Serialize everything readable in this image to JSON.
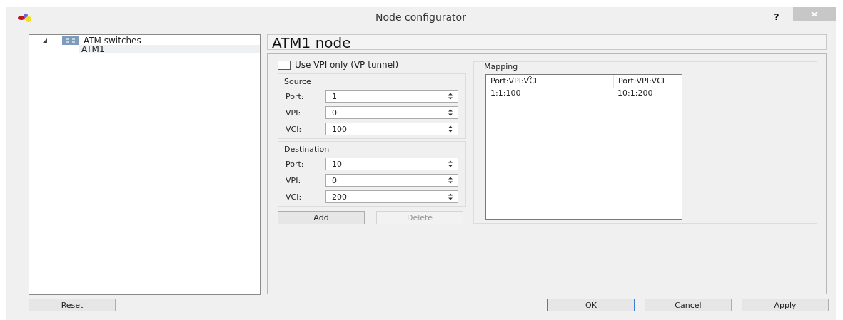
{
  "window": {
    "title": "Node configurator",
    "help": "?"
  },
  "tree": [
    {
      "label": "ATM switches",
      "expanded": true,
      "selected": false,
      "children": [
        {
          "label": "ATM1",
          "selected": true
        }
      ]
    }
  ],
  "node_title": "ATM1 node",
  "vp_tunnel": {
    "label": "Use VPI only (VP tunnel)",
    "checked": false
  },
  "groups": [
    {
      "title": "Source",
      "fields": [
        {
          "label": "Port:",
          "value": "1"
        },
        {
          "label": "VPI:",
          "value": "0"
        },
        {
          "label": "VCI:",
          "value": "100"
        }
      ]
    },
    {
      "title": "Destination",
      "fields": [
        {
          "label": "Port:",
          "value": "10"
        },
        {
          "label": "VPI:",
          "value": "0"
        },
        {
          "label": "VCI:",
          "value": "200"
        }
      ]
    }
  ],
  "edit_buttons": [
    {
      "label": "Add",
      "disabled": false
    },
    {
      "label": "Delete",
      "disabled": true
    }
  ],
  "mapping": {
    "title": "Mapping",
    "columns": [
      {
        "label": "Port:VPI:VCI",
        "sorted": true
      },
      {
        "label": "Port:VPI:VCI",
        "sorted": false
      }
    ],
    "rows": [
      [
        "1:1:100",
        "10:1:200"
      ]
    ]
  },
  "reset_button": "Reset",
  "dialog_buttons": [
    {
      "label": "OK",
      "default": true
    },
    {
      "label": "Cancel",
      "default": false
    },
    {
      "label": "Apply",
      "default": false
    }
  ]
}
